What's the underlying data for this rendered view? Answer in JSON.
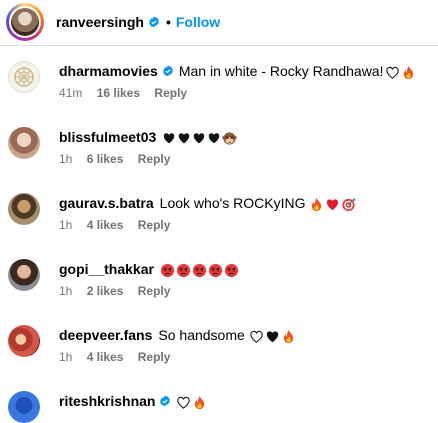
{
  "post_header": {
    "username": "ranveersingh",
    "separator": "•",
    "follow_label": "Follow"
  },
  "colors": {
    "link_blue": "#0095f6",
    "verified_blue": "#0095f6",
    "meta_gray": "#737373"
  },
  "comments": [
    {
      "username": "dharmamovies",
      "verified": true,
      "text": "Man in white - Rocky Randhawa!",
      "emojis": [
        "white-heart-icon",
        "fire-icon"
      ],
      "time": "41m",
      "likes": "16 likes",
      "reply": "Reply"
    },
    {
      "username": "blissfulmeet03",
      "verified": false,
      "text": "",
      "emojis": [
        "black-heart-icon",
        "black-heart-icon",
        "black-heart-icon",
        "black-heart-icon",
        "see-no-evil-monkey-icon"
      ],
      "time": "1h",
      "likes": "6 likes",
      "reply": "Reply"
    },
    {
      "username": "gaurav.s.batra",
      "verified": false,
      "text": "Look who's ROCKyING",
      "emojis": [
        "fire-icon",
        "red-heart-icon",
        "direct-hit-icon"
      ],
      "time": "1h",
      "likes": "4 likes",
      "reply": "Reply"
    },
    {
      "username": "gopi__thakkar",
      "verified": false,
      "text": "",
      "emojis": [
        "angry-face-icon",
        "angry-face-icon",
        "angry-face-icon",
        "angry-face-icon",
        "angry-face-icon"
      ],
      "time": "1h",
      "likes": "2 likes",
      "reply": "Reply"
    },
    {
      "username": "deepveer.fans",
      "verified": false,
      "text": "So handsome",
      "emojis": [
        "white-heart-icon",
        "black-heart-icon",
        "fire-icon"
      ],
      "time": "1h",
      "likes": "4 likes",
      "reply": "Reply"
    },
    {
      "username": "riteshkrishnan",
      "verified": true,
      "text": "",
      "emojis": [
        "white-heart-icon",
        "fire-icon"
      ],
      "time": "",
      "likes": "",
      "reply": ""
    }
  ]
}
